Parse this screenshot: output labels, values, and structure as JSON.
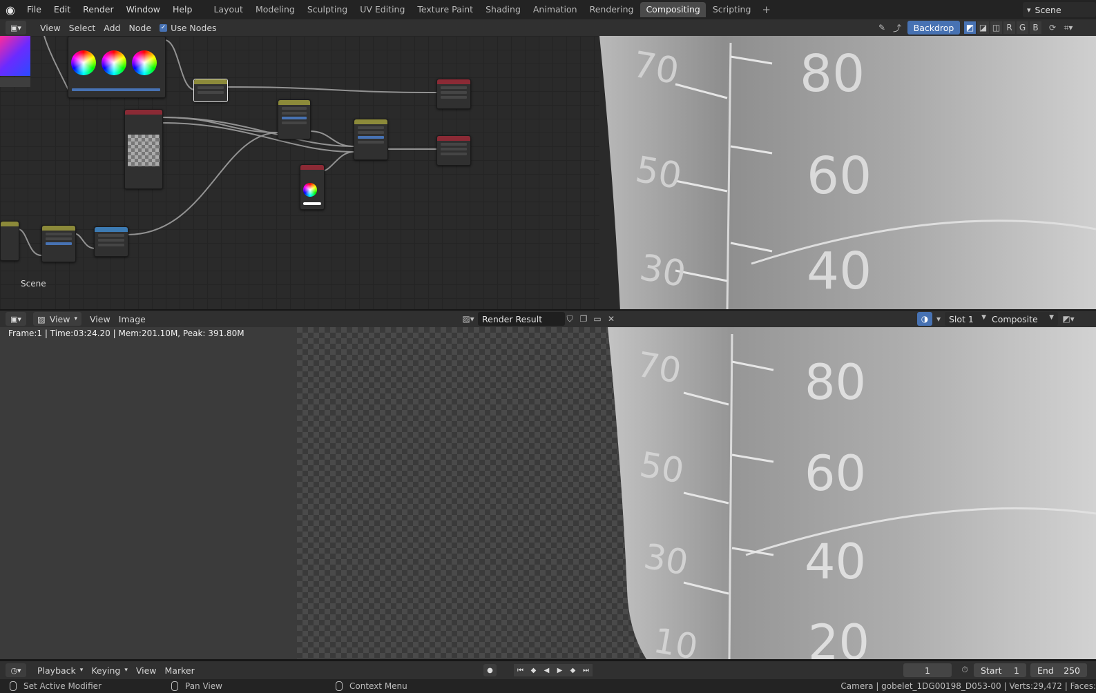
{
  "topbar": {
    "menu": [
      "File",
      "Edit",
      "Render",
      "Window",
      "Help"
    ],
    "workspaces": [
      "Layout",
      "Modeling",
      "Sculpting",
      "UV Editing",
      "Texture Paint",
      "Shading",
      "Animation",
      "Rendering",
      "Compositing",
      "Scripting"
    ],
    "active_workspace": "Compositing",
    "add_tab": "+",
    "scene": "Scene"
  },
  "node_editor": {
    "menu": [
      "View",
      "Select",
      "Add",
      "Node"
    ],
    "use_nodes_label": "Use Nodes",
    "use_nodes_checked": true,
    "backdrop_label": "Backdrop",
    "channels": [
      "R",
      "G",
      "B"
    ],
    "scene_label": "Scene"
  },
  "image_editor": {
    "view_label": "View",
    "menu": [
      "View",
      "Image"
    ],
    "image_name": "Render Result",
    "slot": "Slot 1",
    "pass": "Composite",
    "frame_info": "Frame:1 | Time:03:24.20 | Mem:201.10M, Peak: 391.80M"
  },
  "backdrop_ticks": [
    "70",
    "80",
    "50",
    "60",
    "30",
    "40"
  ],
  "render_ticks": [
    "70",
    "80",
    "50",
    "60",
    "30",
    "40",
    "10",
    "20"
  ],
  "timeline": {
    "menu": [
      "Playback",
      "Keying",
      "View",
      "Marker"
    ],
    "current_frame": "1",
    "start_label": "Start",
    "start_value": "1",
    "end_label": "End",
    "end_value": "250"
  },
  "status": {
    "left": "Set Active Modifier",
    "middle": "Pan View",
    "right": "Context Menu",
    "info": "Camera | gobelet_1DG00198_D053-00 | Verts:29,472 | Faces:"
  },
  "colors": {
    "accent": "#4772b3",
    "node_header_yellow": "#8c8a3a",
    "node_header_red": "#8b2a35",
    "node_header_blue": "#3d7bb3"
  }
}
